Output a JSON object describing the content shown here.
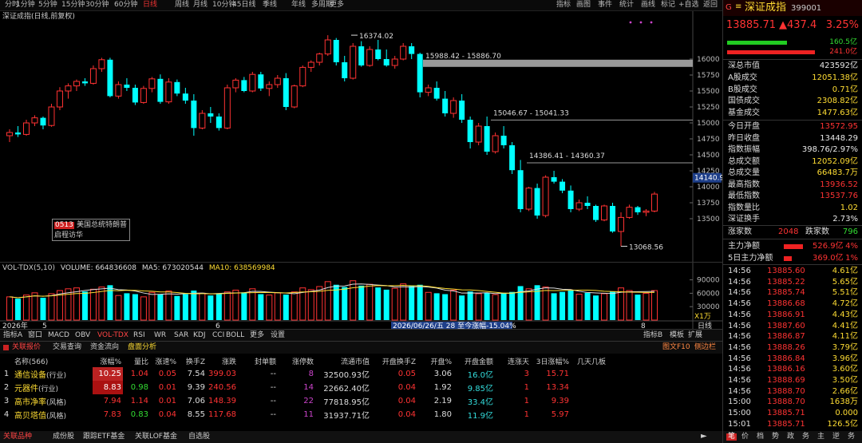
{
  "topbar": {
    "periods": [
      "分时",
      "1分钟",
      "5分钟",
      "15分钟",
      "30分钟",
      "60分钟",
      "日线",
      "周线",
      "月线",
      "10分钟",
      "45日线",
      "季线",
      "年线",
      "多周期",
      "更多"
    ],
    "active_index": 6,
    "right_items": [
      "指标",
      "画图",
      "事件",
      "统计",
      "画线",
      "标记",
      "+自选",
      "返回"
    ]
  },
  "chart": {
    "title": "深证成指(日线,前复权)",
    "annotations": {
      "high": "16374.02",
      "low": "13068.56",
      "band1": "15988.42 - 15886.70",
      "band2": "15046.67 - 15041.33",
      "band3": "14386.41 - 14360.37",
      "price_flag": "14140.9"
    },
    "news_code": "0513",
    "news_line1": "美国总统特朗普",
    "news_line2": "启程访华"
  },
  "chart_data": {
    "type": "candlestick",
    "y_ticks": [
      "16000",
      "15750",
      "15500",
      "15250",
      "15000",
      "14750",
      "14500",
      "14250",
      "14000",
      "13750",
      "13500"
    ],
    "ohlc": [
      [
        14800,
        14900,
        14700,
        14850
      ],
      [
        14850,
        14950,
        14780,
        14820
      ],
      [
        14820,
        15050,
        14800,
        15000
      ],
      [
        15000,
        15120,
        14950,
        15080
      ],
      [
        15080,
        15100,
        14900,
        14960
      ],
      [
        14960,
        15300,
        14940,
        15250
      ],
      [
        15250,
        15560,
        15200,
        15500
      ],
      [
        15500,
        15620,
        15380,
        15580
      ],
      [
        15580,
        15680,
        15500,
        15650
      ],
      [
        15650,
        15700,
        15580,
        15620
      ],
      [
        15620,
        15900,
        15600,
        15850
      ],
      [
        15850,
        16020,
        15800,
        15990
      ],
      [
        15990,
        16020,
        15400,
        15420
      ],
      [
        15420,
        15650,
        15380,
        15600
      ],
      [
        15600,
        15700,
        15500,
        15550
      ],
      [
        15550,
        15600,
        15280,
        15320
      ],
      [
        15320,
        15580,
        15300,
        15540
      ],
      [
        15540,
        15720,
        15480,
        15690
      ],
      [
        15690,
        15760,
        15300,
        15330
      ],
      [
        15330,
        15700,
        15300,
        15640
      ],
      [
        15640,
        15680,
        15420,
        15460
      ],
      [
        15460,
        15550,
        15300,
        15350
      ],
      [
        15350,
        15450,
        14800,
        14920
      ],
      [
        14920,
        15200,
        14900,
        15150
      ],
      [
        15150,
        15250,
        15000,
        15100
      ],
      [
        15100,
        15150,
        14880,
        14920
      ],
      [
        14920,
        15600,
        14900,
        15550
      ],
      [
        15550,
        15700,
        15480,
        15670
      ],
      [
        15670,
        15720,
        15480,
        15500
      ],
      [
        15500,
        15800,
        15480,
        15760
      ],
      [
        15760,
        15800,
        15500,
        15540
      ],
      [
        15540,
        15650,
        15420,
        15600
      ],
      [
        15600,
        15750,
        15550,
        15700
      ],
      [
        15700,
        15780,
        15200,
        15250
      ],
      [
        15250,
        15600,
        15230,
        15580
      ],
      [
        15580,
        15900,
        15560,
        15870
      ],
      [
        15870,
        15980,
        15800,
        15950
      ],
      [
        15950,
        16100,
        15900,
        16080
      ],
      [
        16080,
        16374,
        16050,
        16300
      ],
      [
        16300,
        16330,
        15900,
        15950
      ],
      [
        15950,
        16050,
        15650,
        15700
      ],
      [
        15700,
        16250,
        15680,
        16200
      ],
      [
        16200,
        16280,
        15880,
        15900
      ],
      [
        15900,
        16200,
        15880,
        16150
      ],
      [
        16150,
        16300,
        15980,
        16000
      ],
      [
        16000,
        16150,
        15880,
        15900
      ],
      [
        15900,
        16050,
        15850,
        16000
      ],
      [
        16000,
        16250,
        15980,
        16200
      ],
      [
        16200,
        16250,
        16000,
        16080
      ],
      [
        16080,
        16100,
        15400,
        15480
      ],
      [
        15480,
        15600,
        15420,
        15550
      ],
      [
        15550,
        15650,
        15350,
        15380
      ],
      [
        15380,
        15500,
        15100,
        15150
      ],
      [
        15150,
        15400,
        15080,
        15350
      ],
      [
        15350,
        15450,
        15000,
        15050
      ],
      [
        15050,
        15100,
        14600,
        14700
      ],
      [
        14700,
        15000,
        14650,
        14950
      ],
      [
        14950,
        15100,
        14500,
        14550
      ],
      [
        14550,
        14850,
        14520,
        14800
      ],
      [
        14800,
        14950,
        14600,
        14650
      ],
      [
        14650,
        14700,
        14200,
        14260
      ],
      [
        14260,
        14420,
        13600,
        13650
      ],
      [
        13650,
        14000,
        13620,
        13980
      ],
      [
        13980,
        14050,
        13500,
        13550
      ],
      [
        13550,
        14180,
        13520,
        14150
      ],
      [
        14150,
        14250,
        14050,
        14080
      ],
      [
        14080,
        14120,
        13900,
        13940
      ],
      [
        13940,
        14020,
        13600,
        13650
      ],
      [
        13650,
        13800,
        13620,
        13750
      ],
      [
        13750,
        13850,
        13650,
        13700
      ],
      [
        13700,
        13720,
        13450,
        13480
      ],
      [
        13480,
        13720,
        13460,
        13700
      ],
      [
        13700,
        13750,
        13280,
        13300
      ],
      [
        13300,
        13600,
        13068,
        13520
      ],
      [
        13520,
        13720,
        13500,
        13680
      ],
      [
        13680,
        13700,
        13560,
        13600
      ],
      [
        13600,
        13650,
        13540,
        13620
      ],
      [
        13620,
        13920,
        13600,
        13886
      ]
    ],
    "colors": {
      "up": "#ff3232",
      "down": "#00ffff"
    }
  },
  "vol": {
    "header_name": "VOL-TDX(5,10)",
    "header_volume": "VOLUME: 664836608",
    "header_ma5": "MA5: 673020544",
    "header_ma10": "MA10: 638569984",
    "ticks": [
      "90000",
      "60000",
      "30000"
    ],
    "unit": "X1万",
    "xaxis_year": "2026年",
    "xaxis_m5": "5",
    "xaxis_m6": "6",
    "xaxis_date": "2026/06/26/五 28 至今涨幅-15.04%",
    "xaxis_m8": "8",
    "xaxis_label": "日线",
    "values": [
      52,
      48,
      56,
      61,
      50,
      59,
      66,
      70,
      72,
      64,
      69,
      74,
      78,
      55,
      60,
      58,
      52,
      62,
      57,
      65,
      54,
      58,
      66,
      60,
      55,
      59,
      63,
      67,
      62,
      70,
      58,
      56,
      61,
      57,
      63,
      72,
      68,
      75,
      86,
      79,
      74,
      88,
      77,
      80,
      73,
      68,
      71,
      81,
      76,
      79,
      62,
      60,
      58,
      67,
      55,
      64,
      59,
      61,
      57,
      60,
      63,
      76,
      70,
      78,
      74,
      60,
      63,
      67,
      58,
      61,
      55,
      59,
      64,
      72,
      66,
      57,
      60,
      66
    ]
  },
  "indicator_tabs": {
    "items": [
      "指标A",
      "窗口",
      "MACD",
      "OBV",
      "VOL-TDX",
      "RSI",
      "WR",
      "SAR",
      "KDJ",
      "CCI",
      "BOLL",
      "更多",
      "设置"
    ],
    "active_index": 4,
    "right": [
      "指标B",
      "模板",
      "扩展"
    ]
  },
  "sector_tabs": {
    "items": [
      "关联报价",
      "交易查询",
      "资金流向",
      "盘面分析"
    ],
    "right1": "图文F10",
    "right2": "侧边栏"
  },
  "table": {
    "headers": [
      "名称(566)",
      "涨幅%",
      "量比",
      "涨速%",
      "换手Z",
      "涨跌",
      "封单额",
      "涨停数",
      "流通市值",
      "开盘换手Z",
      "开盘%",
      "开盘金额",
      "连涨天",
      "3日涨幅%",
      "几天几板"
    ],
    "rows": [
      [
        "1",
        "通信设备",
        "(行业)",
        "10.25",
        "1.04",
        "0.05",
        "7.54",
        "399.03",
        "--",
        "8",
        "32500.93亿",
        "0.05",
        "3.06",
        "16.0亿",
        "3",
        "15.71"
      ],
      [
        "2",
        "元器件",
        "(行业)",
        "8.83",
        "0.98",
        "0.01",
        "9.39",
        "240.56",
        "--",
        "14",
        "22662.40亿",
        "0.04",
        "1.92",
        "9.85亿",
        "1",
        "13.34"
      ],
      [
        "3",
        "高市净率",
        "(风格)",
        "7.94",
        "1.14",
        "0.01",
        "7.06",
        "148.39",
        "--",
        "22",
        "77818.95亿",
        "0.04",
        "2.19",
        "33.4亿",
        "1",
        "9.39"
      ],
      [
        "4",
        "高贝塔值",
        "(风格)",
        "7.83",
        "0.83",
        "0.04",
        "8.55",
        "117.68",
        "--",
        "11",
        "31937.71亿",
        "0.04",
        "1.80",
        "11.9亿",
        "1",
        "5.97"
      ]
    ]
  },
  "bottom_tabs": [
    "关联品种",
    "成份股",
    "跟踪ETF基金",
    "关联LOF基金",
    "自选股"
  ],
  "side": {
    "g": "G",
    "eq": "≡",
    "name": "深证成指",
    "code": "399001",
    "price": "13885.71",
    "change": "▲437.4",
    "pct": "3.25%",
    "bar1_val": "160.5亿",
    "bar2_val": "241.0亿",
    "stats": [
      {
        "label": "深总市值",
        "value": "423592亿",
        "color": "wht"
      },
      {
        "label": "A股成交",
        "value": "12051.38亿",
        "color": "yel"
      },
      {
        "label": "B股成交",
        "value": "0.71亿",
        "color": "yel"
      },
      {
        "label": "国债成交",
        "value": "2308.82亿",
        "color": "yel"
      },
      {
        "label": "基金成交",
        "value": "1477.63亿",
        "color": "yel"
      }
    ],
    "stats2": [
      {
        "label": "今日开盘",
        "value": "13572.95",
        "color": "red"
      },
      {
        "label": "昨日收盘",
        "value": "13448.29",
        "color": "wht"
      },
      {
        "label": "指数振幅",
        "value": "398.76/2.97%",
        "color": "wht"
      },
      {
        "label": "总成交额",
        "value": "12052.09亿",
        "color": "yel"
      },
      {
        "label": "总成交量",
        "value": "66483.7万",
        "color": "yel"
      },
      {
        "label": "最高指数",
        "value": "13936.52",
        "color": "red"
      },
      {
        "label": "最低指数",
        "value": "13537.76",
        "color": "red"
      },
      {
        "label": "指数量比",
        "value": "1.02",
        "color": "yel"
      },
      {
        "label": "深证换手",
        "value": "2.73%",
        "color": "wht"
      }
    ],
    "up_label": "涨家数",
    "up_val": "2048",
    "down_label": "跌家数",
    "down_val": "796",
    "flow1_label": "主力净额",
    "flow1_val": "526.9亿",
    "flow1_pct": "4%",
    "flow2_label": "5日主力净额",
    "flow2_val": "369.0亿",
    "flow2_pct": "1%",
    "ticks": [
      [
        "14:56",
        "13885.60",
        "4.61亿"
      ],
      [
        "14:56",
        "13885.22",
        "5.65亿"
      ],
      [
        "14:56",
        "13885.74",
        "5.51亿"
      ],
      [
        "14:56",
        "13886.68",
        "4.72亿"
      ],
      [
        "14:56",
        "13886.91",
        "4.43亿"
      ],
      [
        "14:56",
        "13887.60",
        "4.41亿"
      ],
      [
        "14:56",
        "13886.87",
        "4.11亿"
      ],
      [
        "14:56",
        "13888.26",
        "3.79亿"
      ],
      [
        "14:56",
        "13886.84",
        "3.96亿"
      ],
      [
        "14:56",
        "13886.16",
        "3.60亿"
      ],
      [
        "14:56",
        "13888.69",
        "3.50亿"
      ],
      [
        "14:56",
        "13888.70",
        "2.66亿"
      ],
      [
        "15:00",
        "13888.70",
        "1638万"
      ],
      [
        "15:00",
        "13885.71",
        "0.000"
      ],
      [
        "15:01",
        "13885.71",
        "126.5亿"
      ]
    ],
    "bottom": [
      "笔",
      "价",
      "档",
      "势",
      "政",
      "务",
      "主",
      "逆",
      "务"
    ]
  }
}
